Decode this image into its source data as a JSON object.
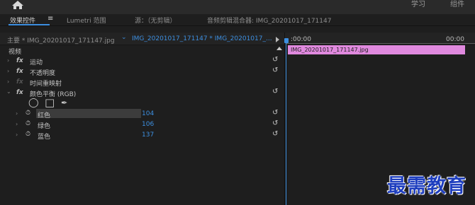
{
  "topbar": {
    "workspace_learn": "学习",
    "workspace_assembly": "组件"
  },
  "tabs": {
    "effect_controls": "效果控件",
    "menu_glyph": "≡",
    "lumetri": "Lumetri 范围",
    "source": "源：（无剪辑）",
    "audio_mixer": "音频剪辑混合器: IMG_20201017_171147"
  },
  "clipbar": {
    "master_clip": "主要 * IMG_20201017_171147.jpg",
    "sequence_clip": "IMG_20201017_171147 * IMG_20201017_..."
  },
  "timeline": {
    "timecode_start": ":00:00",
    "timecode_end": "00:00",
    "clip_name": "IMG_20201017_171147.jpg",
    "clip_color": "#e089de"
  },
  "properties": {
    "video_header": "视频",
    "motion": "运动",
    "opacity": "不透明度",
    "time_remap": "时间重映射",
    "color_balance": "颜色平衡 (RGB)",
    "red_label": "红色",
    "red_value": "104",
    "green_label": "绿色",
    "green_value": "106",
    "blue_label": "蓝色",
    "blue_value": "137"
  },
  "icons": {
    "fx": "fx",
    "reset": "↺",
    "chevron_right": "›",
    "chevron_down": "⌄",
    "stopwatch": "⏱",
    "ellipse": "◯",
    "rectangle": "□",
    "pen": "✒"
  },
  "watermark": "最需教育",
  "accent_color": "#3d8fe0"
}
